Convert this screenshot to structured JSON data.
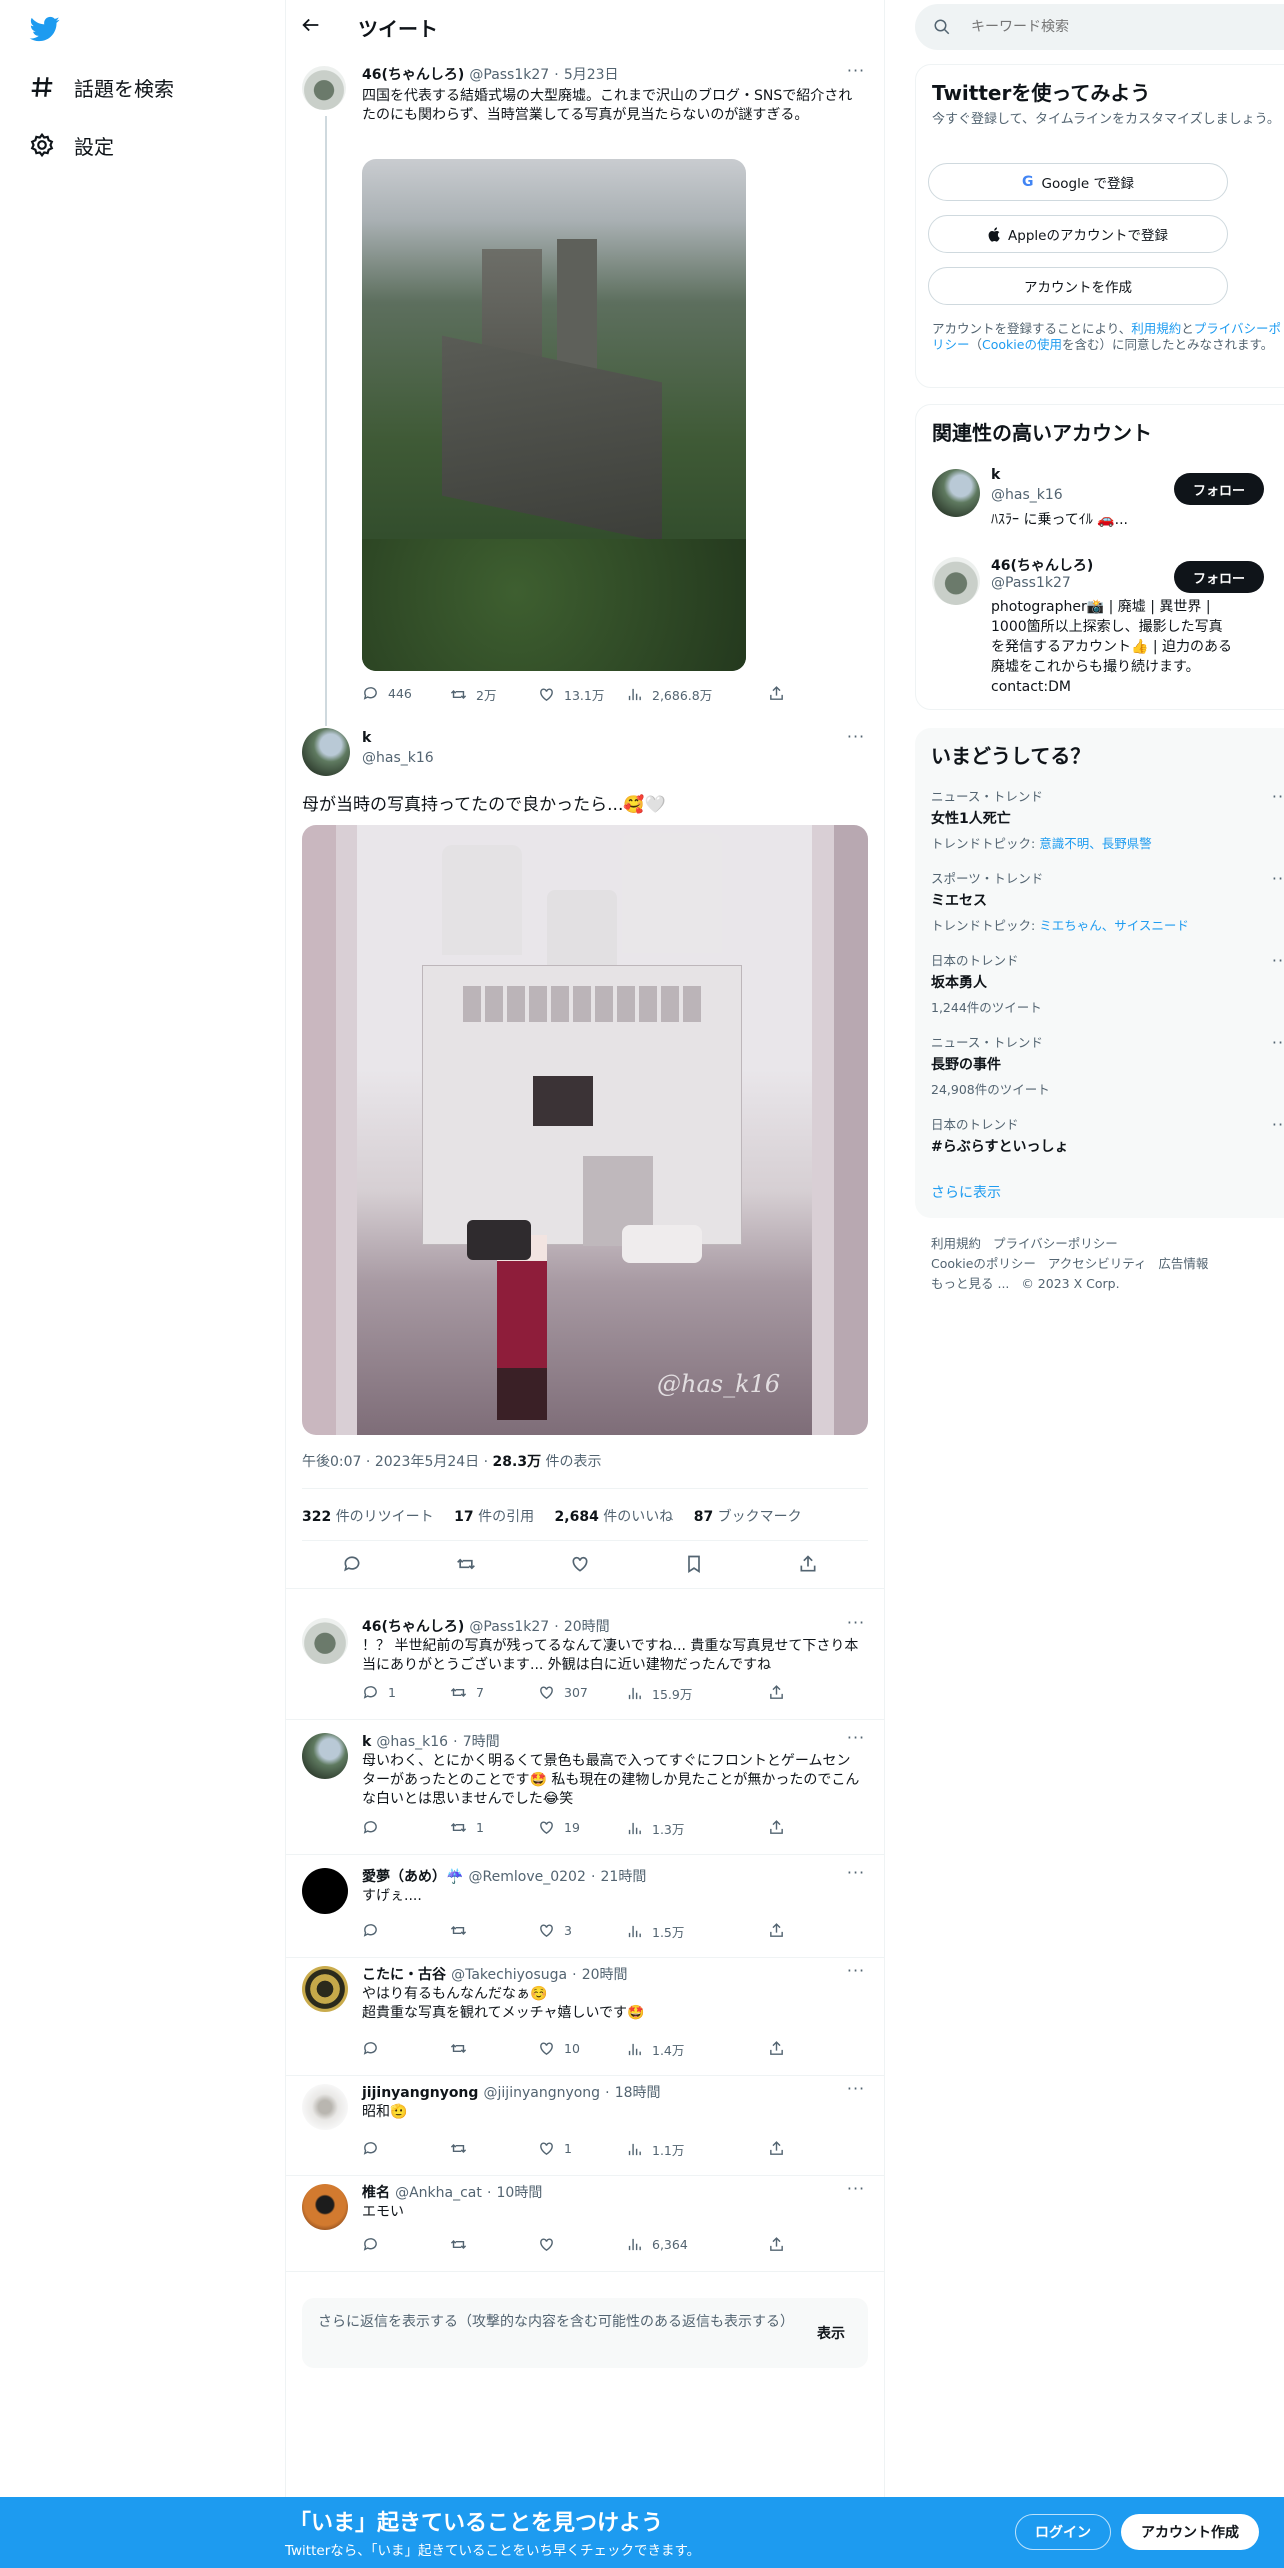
{
  "nav": {
    "logo": "twitter-bird",
    "explore_label": "話題を検索",
    "settings_label": "設定"
  },
  "header": {
    "title": "ツイート"
  },
  "parent_tweet": {
    "name": "46(ちゃんしろ)",
    "handle": "@Pass1k27",
    "date": "5月23日",
    "text": "四国を代表する結婚式場の大型廃墟。これまで沢山のブログ・SNSで紹介されたのにも関わらず、当時営業してる写真が見当たらないのが謎すぎる。",
    "replies": "446",
    "retweets": "2万",
    "likes": "13.1万",
    "views": "2,686.8万"
  },
  "main_tweet": {
    "name": "k",
    "handle": "@has_k16",
    "text": "母が当時の写真持ってたので良かったら...🥰🤍",
    "watermark": "@has_k16",
    "time": "午後0:07",
    "date": "2023年5月24日",
    "views_count": "28.3万",
    "views_label": "件の表示",
    "retweets_count": "322",
    "retweets_label": "件のリツイート",
    "quotes_count": "17",
    "quotes_label": "件の引用",
    "likes_count": "2,684",
    "likes_label": "件のいいね",
    "bookmarks_count": "87",
    "bookmarks_label": "ブックマーク"
  },
  "replies": [
    {
      "name": "46(ちゃんしろ)",
      "handle": "@Pass1k27",
      "time": "20時間",
      "text": "！？ 半世紀前の写真が残ってるなんて凄いですね... 貴重な写真見せて下さり本当にありがとうございます... 外観は白に近い建物だったんですね",
      "replies": "1",
      "retweets": "7",
      "likes": "307",
      "views": "15.9万"
    },
    {
      "name": "k",
      "handle": "@has_k16",
      "time": "7時間",
      "text": "母いわく、とにかく明るくて景色も最高で入ってすぐにフロントとゲームセンターがあったとのことです🤩 私も現在の建物しか見たことが無かったのでこんな白いとは思いませんでした😂笑",
      "replies": "",
      "retweets": "1",
      "likes": "19",
      "views": "1.3万"
    },
    {
      "name": "愛夢（あめ）☔️",
      "handle": "@Remlove_0202",
      "time": "21時間",
      "text": "すげぇ....",
      "replies": "",
      "retweets": "",
      "likes": "3",
      "views": "1.5万"
    },
    {
      "name": "こたに・古谷",
      "handle": "@Takechiyosuga",
      "time": "20時間",
      "text": "やはり有るもんなんだなぁ☺️\n超貴重な写真を観れてメッチャ嬉しいです🤩",
      "replies": "",
      "retweets": "",
      "likes": "10",
      "views": "1.4万"
    },
    {
      "name": "jijinyangnyong",
      "handle": "@jijinyangnyong",
      "time": "18時間",
      "text": "昭和🫡",
      "replies": "",
      "retweets": "",
      "likes": "1",
      "views": "1.1万"
    },
    {
      "name": "椎名",
      "handle": "@Ankha_cat",
      "time": "10時間",
      "text": "エモい",
      "replies": "",
      "retweets": "",
      "likes": "",
      "views": "6,364"
    }
  ],
  "show_more": {
    "text": "さらに返信を表示する（攻撃的な内容を含む可能性のある返信も表示する）",
    "button": "表示"
  },
  "sidebar": {
    "search_placeholder": "キーワード検索",
    "signup": {
      "title": "Twitterを使ってみよう",
      "subtitle": "今すぐ登録して、タイムラインをカスタマイズしましょう。",
      "google": "Google で登録",
      "apple": "Appleのアカウントで登録",
      "create": "アカウントを作成",
      "terms_a": "アカウントを登録することにより、",
      "terms_link1": "利用規約",
      "terms_b": "と",
      "terms_link2": "プライバシーポリシー",
      "terms_c": "（",
      "terms_link3": "Cookieの使用",
      "terms_d": "を含む）に同意したとみなされます。"
    },
    "related": {
      "title": "関連性の高いアカウント",
      "follow": "フォロー",
      "accounts": [
        {
          "name": "k",
          "handle": "@has_k16",
          "bio": "ﾊｽﾗｰ に乗ってｲﾙ 🚗..."
        },
        {
          "name": "46(ちゃんしろ)",
          "handle": "@Pass1k27",
          "bio": "photographer📸 | 廃墟 | 異世界 | 1000箇所以上探索し、撮影した写真を発信するアカウント👍 | 迫力のある廃墟をこれからも撮り続けます。 contact:DM"
        }
      ]
    },
    "trends": {
      "title": "いまどうしてる？",
      "items": [
        {
          "context": "ニュース・トレンド",
          "name": "女性1人死亡",
          "extra_a": "トレンドトピック: ",
          "extra_link": "意識不明、長野県警",
          "extra_b": ""
        },
        {
          "context": "スポーツ・トレンド",
          "name": "ミエセス",
          "extra_a": "トレンドトピック: ",
          "extra_link": "ミエちゃん、サイスニード",
          "extra_b": ""
        },
        {
          "context": "日本のトレンド",
          "name": "坂本勇人",
          "extra_a": "1,244件のツイート",
          "extra_link": "",
          "extra_b": ""
        },
        {
          "context": "ニュース・トレンド",
          "name": "長野の事件",
          "extra_a": "24,908件のツイート",
          "extra_link": "",
          "extra_b": ""
        },
        {
          "context": "日本のトレンド",
          "name": "#らぶらすといっしょ",
          "extra_a": "",
          "extra_link": "",
          "extra_b": ""
        }
      ],
      "show_more": "さらに表示"
    },
    "footer": {
      "terms": "利用規約",
      "privacy": "プライバシーポリシー",
      "cookie": "Cookieのポリシー",
      "accessibility": "アクセシビリティ",
      "ads": "広告情報",
      "more": "もっと見る ...",
      "copyright": "© 2023 X Corp."
    }
  },
  "bottom_bar": {
    "title": "「いま」起きていることを見つけよう",
    "subtitle": "Twitterなら、「いま」起きていることをいち早くチェックできます。",
    "login": "ログイン",
    "signup": "アカウント作成"
  },
  "colors": {
    "accent": "#1d9bf0",
    "text": "#0f1419",
    "muted": "#536471",
    "border": "#eff3f4"
  }
}
